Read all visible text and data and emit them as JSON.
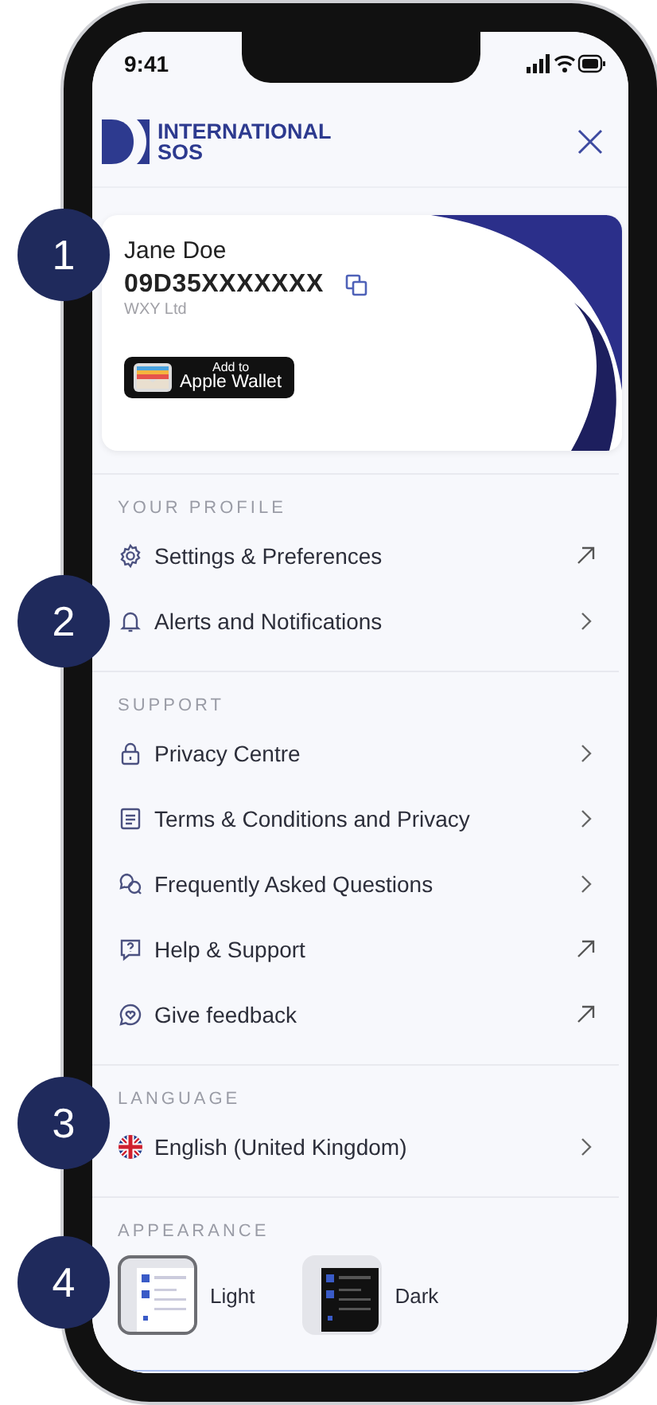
{
  "status_bar": {
    "time": "9:41"
  },
  "header": {
    "logo_line1": "INTERNATIONAL",
    "logo_line2": "SOS"
  },
  "member_card": {
    "name": "Jane Doe",
    "member_id": "09D35XXXXXXX",
    "company": "WXY Ltd",
    "wallet_button": {
      "line1": "Add to",
      "line2": "Apple Wallet"
    }
  },
  "sections": [
    {
      "title": "YOUR PROFILE",
      "items": [
        {
          "label": "Settings & Preferences",
          "kind": "external"
        },
        {
          "label": "Alerts and Notifications",
          "kind": "chevron"
        }
      ]
    },
    {
      "title": "SUPPORT",
      "items": [
        {
          "label": "Privacy Centre",
          "kind": "chevron"
        },
        {
          "label": "Terms & Conditions and Privacy",
          "kind": "chevron"
        },
        {
          "label": "Frequently Asked Questions",
          "kind": "chevron"
        },
        {
          "label": "Help & Support",
          "kind": "external"
        },
        {
          "label": "Give feedback",
          "kind": "external"
        }
      ]
    },
    {
      "title": "LANGUAGE",
      "items": [
        {
          "label": "English (United Kingdom)",
          "kind": "chevron"
        }
      ]
    }
  ],
  "appearance": {
    "title": "APPEARANCE",
    "options": [
      {
        "label": "Light",
        "kind": "light",
        "selected": true
      },
      {
        "label": "Dark",
        "kind": "dark",
        "selected": false
      }
    ]
  },
  "callouts": [
    "1",
    "2",
    "3",
    "4"
  ]
}
